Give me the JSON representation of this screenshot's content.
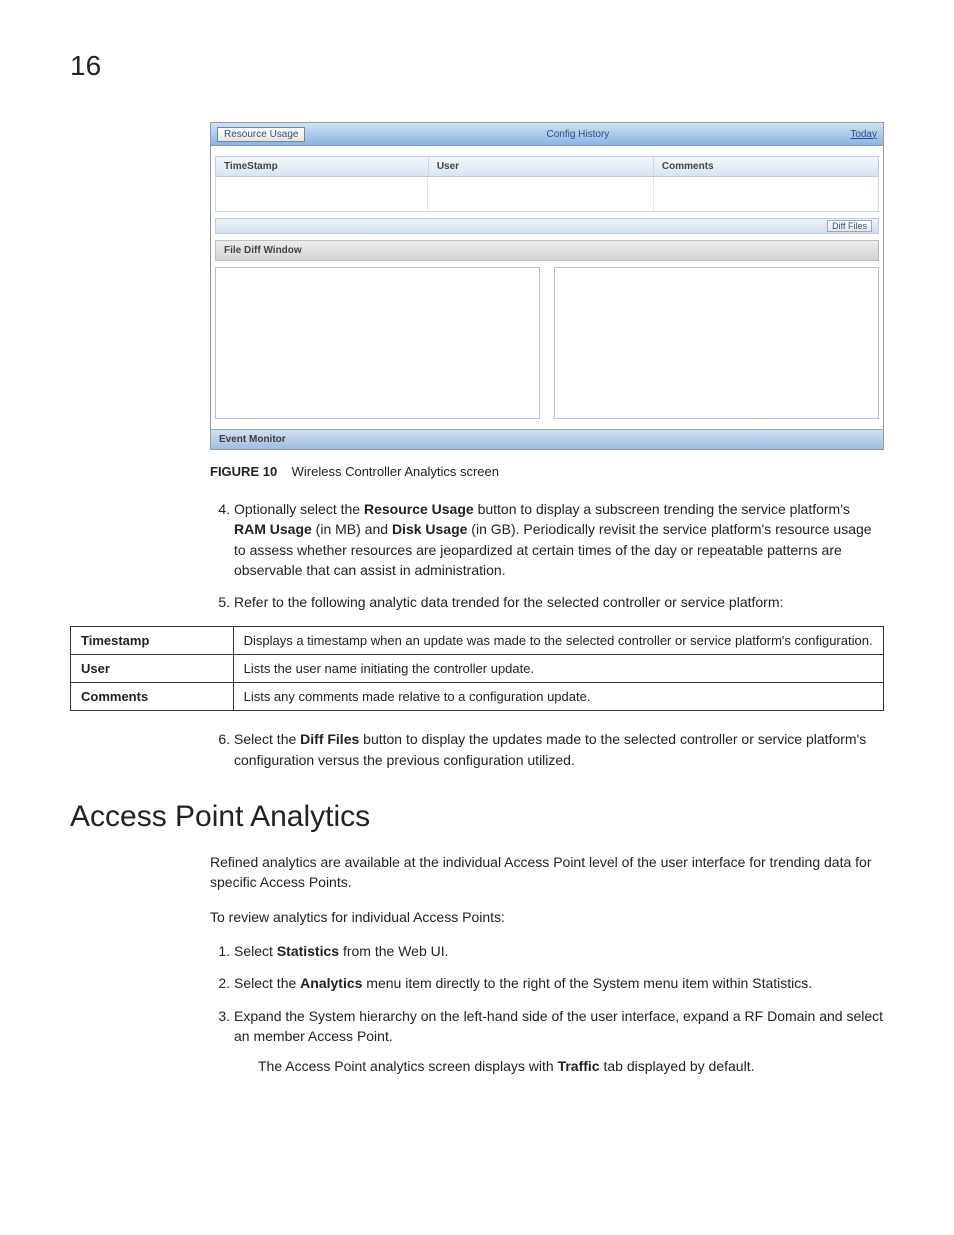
{
  "page_number": "16",
  "screenshot": {
    "toolbar": {
      "button": "Resource Usage",
      "title": "Config History",
      "link": "Today"
    },
    "columns": {
      "timestamp": "TimeStamp",
      "user": "User",
      "comments": "Comments"
    },
    "diff_button": "Diff Files",
    "diff_window_label": "File Diff Window",
    "footer": "Event Monitor"
  },
  "figure": {
    "label": "FIGURE 10",
    "caption": "Wireless Controller Analytics screen"
  },
  "step4": {
    "pre": "Optionally select the ",
    "btn": "Resource Usage",
    "mid1": " button to display a subscreen trending the service platform's ",
    "ram": "RAM Usage",
    "mid2": " (in MB) and ",
    "disk": "Disk Usage",
    "tail": " (in GB). Periodically revisit the service platform's resource usage to assess whether resources are jeopardized at certain times of the day or repeatable patterns are observable that can assist in administration."
  },
  "step5": "Refer to the following analytic data trended for the selected controller or service platform:",
  "table": {
    "r1_term": "Timestamp",
    "r1_def": "Displays a timestamp when an update was made to the selected controller or service platform's configuration.",
    "r2_term": "User",
    "r2_def": "Lists the user name initiating the controller update.",
    "r3_term": "Comments",
    "r3_def": "Lists any comments made relative to a configuration update."
  },
  "step6": {
    "pre": "Select the ",
    "btn": "Diff Files",
    "tail": " button to display the updates made to the selected controller or service platform's configuration versus the previous configuration utilized."
  },
  "section_title": "Access Point Analytics",
  "intro_para": "Refined analytics are available at the individual Access Point level of the user interface for trending data for specific Access Points.",
  "review_para": "To review analytics for individual Access Points:",
  "ap_step1": {
    "pre": "Select ",
    "b": "Statistics",
    "tail": " from the Web UI."
  },
  "ap_step2": {
    "pre": "Select the ",
    "b": "Analytics",
    "tail": " menu item directly to the right of the System menu item within Statistics."
  },
  "ap_step3": "Expand the System hierarchy on the left-hand side of the user interface, expand a RF Domain and select an member Access Point.",
  "ap_step3_sub": {
    "pre": "The Access Point analytics screen displays with ",
    "b": "Traffic",
    "tail": " tab displayed by default."
  }
}
